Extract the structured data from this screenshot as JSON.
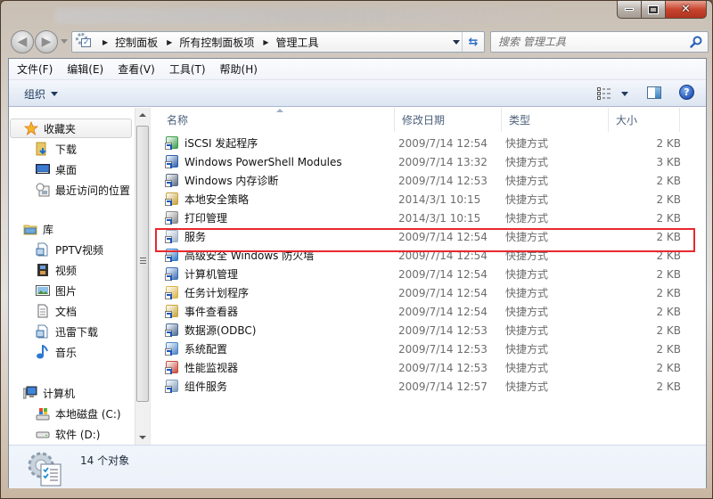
{
  "window": {
    "caption_buttons": {
      "minimize": "minimize",
      "maximize": "maximize",
      "close": "✕"
    }
  },
  "nav": {
    "back_label": "◀",
    "forward_label": "▶",
    "breadcrumb": [
      "控制面板",
      "所有控制面板项",
      "管理工具"
    ],
    "refresh_glyph": "⇆",
    "search": {
      "placeholder": "搜索 管理工具",
      "value": ""
    }
  },
  "menubar": {
    "items": [
      "文件(F)",
      "编辑(E)",
      "查看(V)",
      "工具(T)",
      "帮助(H)"
    ]
  },
  "toolbar": {
    "organize_label": "组织",
    "help_glyph": "?"
  },
  "navpane": {
    "favorites": {
      "label": "收藏夹",
      "items": [
        "下载",
        "桌面",
        "最近访问的位置"
      ]
    },
    "libraries": {
      "label": "库",
      "items": [
        "PPTV视频",
        "视频",
        "图片",
        "文档",
        "迅雷下载",
        "音乐"
      ]
    },
    "computer": {
      "label": "计算机",
      "items": [
        "本地磁盘 (C:)",
        "软件 (D:)"
      ]
    }
  },
  "filelist": {
    "columns": [
      "名称",
      "修改日期",
      "类型",
      "大小"
    ],
    "sorted_column": "名称",
    "rows": [
      {
        "name": "iSCSI 发起程序",
        "date": "2009/7/14 12:54",
        "type": "快捷方式",
        "size": "2 KB",
        "icon": "globe-shortcut-icon"
      },
      {
        "name": "Windows PowerShell Modules",
        "date": "2009/7/14 13:32",
        "type": "快捷方式",
        "size": "3 KB",
        "icon": "powershell-shortcut-icon"
      },
      {
        "name": "Windows 内存诊断",
        "date": "2009/7/14 12:53",
        "type": "快捷方式",
        "size": "2 KB",
        "icon": "memory-diagnostic-icon"
      },
      {
        "name": "本地安全策略",
        "date": "2014/3/1 10:15",
        "type": "快捷方式",
        "size": "2 KB",
        "icon": "security-policy-icon"
      },
      {
        "name": "打印管理",
        "date": "2014/3/1 10:15",
        "type": "快捷方式",
        "size": "2 KB",
        "icon": "print-management-icon"
      },
      {
        "name": "服务",
        "date": "2009/7/14 12:54",
        "type": "快捷方式",
        "size": "2 KB",
        "icon": "services-gear-icon"
      },
      {
        "name": "高级安全 Windows 防火墙",
        "date": "2009/7/14 12:54",
        "type": "快捷方式",
        "size": "2 KB",
        "icon": "firewall-icon"
      },
      {
        "name": "计算机管理",
        "date": "2009/7/14 12:54",
        "type": "快捷方式",
        "size": "2 KB",
        "icon": "computer-management-icon"
      },
      {
        "name": "任务计划程序",
        "date": "2009/7/14 12:54",
        "type": "快捷方式",
        "size": "2 KB",
        "icon": "task-scheduler-icon"
      },
      {
        "name": "事件查看器",
        "date": "2009/7/14 12:54",
        "type": "快捷方式",
        "size": "2 KB",
        "icon": "event-viewer-icon"
      },
      {
        "name": "数据源(ODBC)",
        "date": "2009/7/14 12:53",
        "type": "快捷方式",
        "size": "2 KB",
        "icon": "odbc-icon"
      },
      {
        "name": "系统配置",
        "date": "2009/7/14 12:53",
        "type": "快捷方式",
        "size": "2 KB",
        "icon": "system-config-icon"
      },
      {
        "name": "性能监视器",
        "date": "2009/7/14 12:53",
        "type": "快捷方式",
        "size": "2 KB",
        "icon": "performance-monitor-icon"
      },
      {
        "name": "组件服务",
        "date": "2009/7/14 12:57",
        "type": "快捷方式",
        "size": "2 KB",
        "icon": "component-services-icon"
      }
    ],
    "highlighted_row": "服务"
  },
  "statusbar": {
    "text": "14 个对象"
  },
  "colors": {
    "highlight_border": "#e8282e",
    "header_text": "#4c607a",
    "secondary_text": "#6d6d6d"
  }
}
